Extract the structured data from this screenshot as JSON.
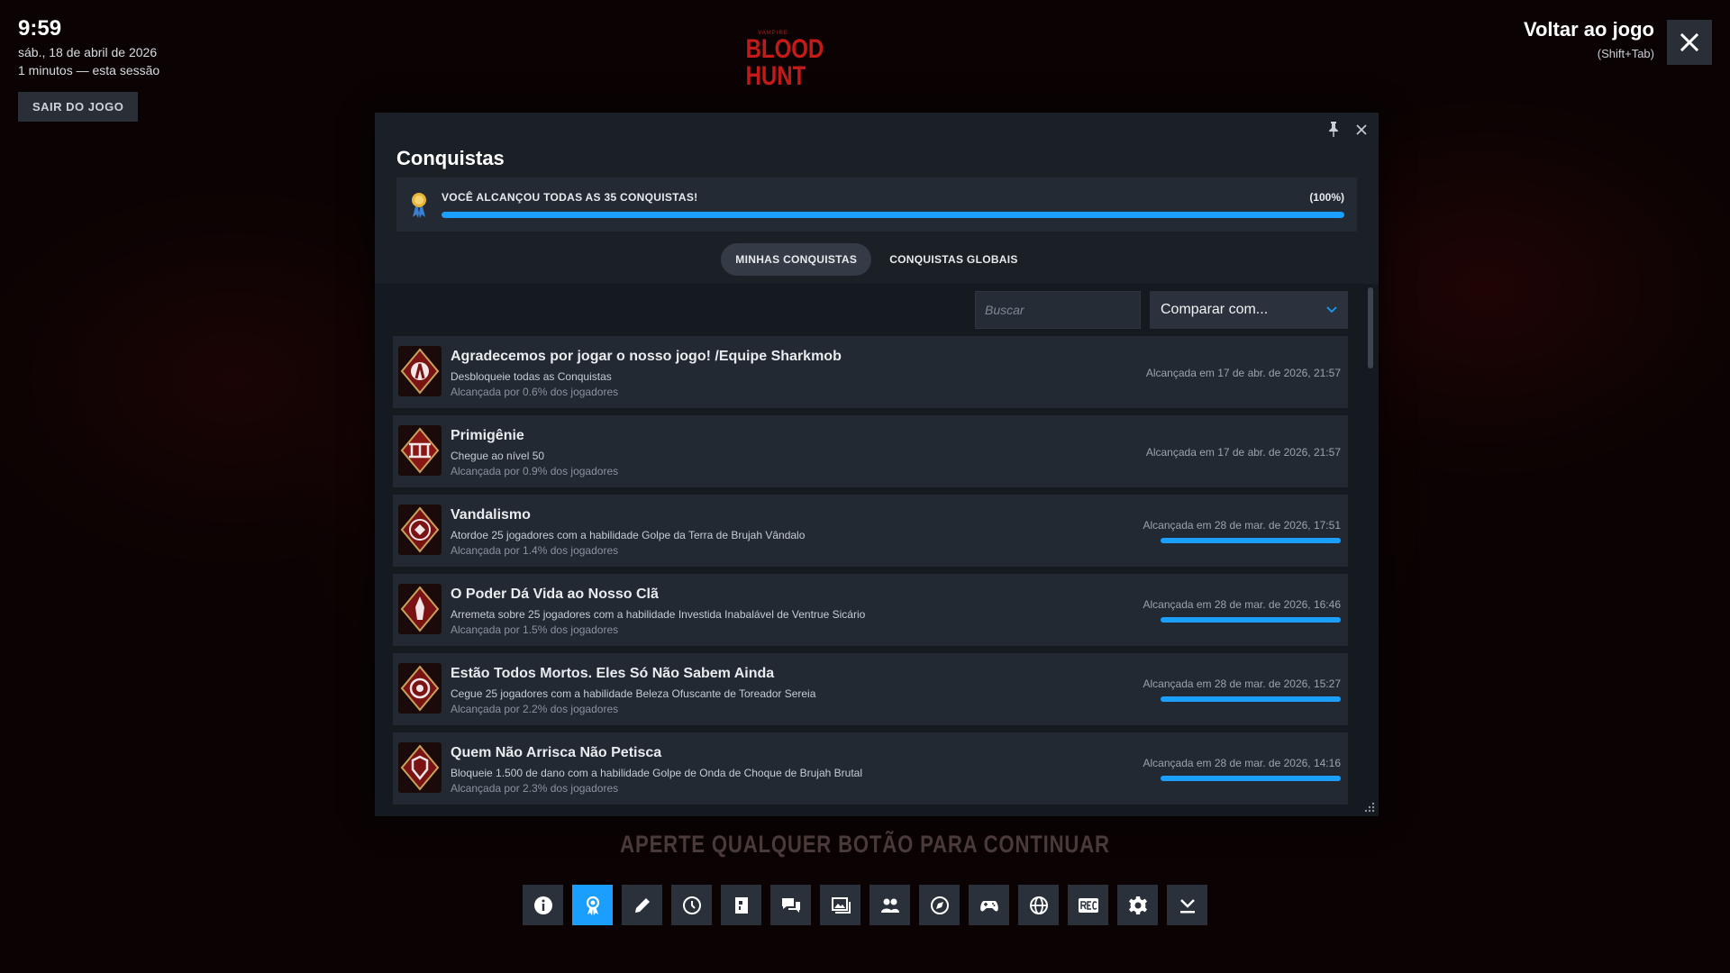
{
  "clock": {
    "time": "9:59",
    "date": "sáb., 18 de abril de 2026",
    "session": "1 minutos — esta sessão",
    "exit_label": "SAIR DO JOGO"
  },
  "return": {
    "label": "Voltar ao jogo",
    "hint": "(Shift+Tab)"
  },
  "logo": {
    "small": "VAMPIRE",
    "line1": "BLOOD",
    "line2": "HUNT"
  },
  "panel": {
    "title": "Conquistas",
    "progress_text": "VOCÊ ALCANÇOU TODAS AS 35 CONQUISTAS!",
    "progress_pct": "(100%)",
    "progress_value": 1.0,
    "tabs": [
      {
        "label": "MINHAS CONQUISTAS",
        "active": true
      },
      {
        "label": "CONQUISTAS GLOBAIS",
        "active": false
      }
    ],
    "search_placeholder": "Buscar",
    "compare_label": "Comparar com..."
  },
  "achievements": [
    {
      "name": "Agradecemos por jogar o nosso jogo! /Equipe Sharkmob",
      "desc": "Desbloqueie todas as Conquistas",
      "pct": "Alcançada por 0.6% dos jogadores",
      "when": "Alcançada em 17 de abr. de 2026, 21:57",
      "has_bar": false
    },
    {
      "name": "Primigênie",
      "desc": "Chegue ao nível 50",
      "pct": "Alcançada por 0.9% dos jogadores",
      "when": "Alcançada em 17 de abr. de 2026, 21:57",
      "has_bar": false
    },
    {
      "name": "Vandalismo",
      "desc": "Atordoe 25 jogadores com a habilidade Golpe da Terra de Brujah Vândalo",
      "pct": "Alcançada por 1.4% dos jogadores",
      "when": "Alcançada em 28 de mar. de 2026, 17:51",
      "has_bar": true
    },
    {
      "name": "O Poder Dá Vida ao Nosso Clã",
      "desc": "Arremeta sobre 25 jogadores com a habilidade Investida Inabalável de Ventrue Sicário",
      "pct": "Alcançada por 1.5% dos jogadores",
      "when": "Alcançada em 28 de mar. de 2026, 16:46",
      "has_bar": true
    },
    {
      "name": "Estão Todos Mortos. Eles Só Não Sabem Ainda",
      "desc": "Cegue 25 jogadores com a habilidade Beleza Ofuscante de Toreador Sereia",
      "pct": "Alcançada por 2.2% dos jogadores",
      "when": "Alcançada em 28 de mar. de 2026, 15:27",
      "has_bar": true
    },
    {
      "name": "Quem Não Arrisca Não Petisca",
      "desc": "Bloqueie 1.500 de dano com a habilidade Golpe de Onda de Choque de Brujah Brutal",
      "pct": "Alcançada por 2.3% dos jogadores",
      "when": "Alcançada em 28 de mar. de 2026, 14:16",
      "has_bar": true
    }
  ],
  "continue_text": "APERTE QUALQUER BOTÃO PARA CONTINUAR",
  "dock": [
    "info-icon",
    "achievements-icon",
    "pencil-icon",
    "history-icon",
    "guide-icon",
    "chat-icon",
    "screenshots-icon",
    "friends-icon",
    "browser-icon",
    "controller-icon",
    "globe-icon",
    "record-icon",
    "settings-icon",
    "download-icon"
  ],
  "colors": {
    "accent": "#1a9fff",
    "panel": "#1b1f26",
    "row": "#232933"
  }
}
